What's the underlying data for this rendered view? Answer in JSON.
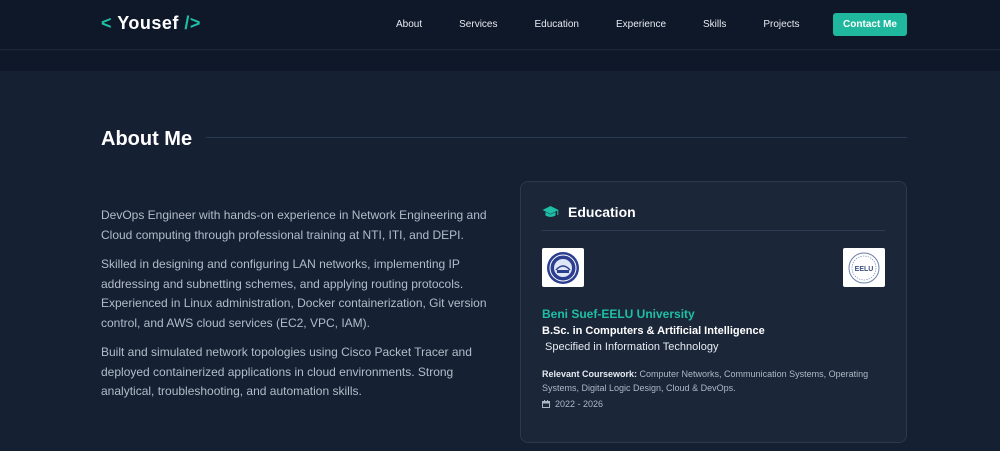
{
  "nav": {
    "logo_open": "<",
    "logo_name": "Yousef",
    "logo_close": "/>",
    "links": [
      "About",
      "Services",
      "Education",
      "Experience",
      "Skills",
      "Projects"
    ],
    "contact_label": "Contact Me"
  },
  "about": {
    "title": "About Me",
    "paragraphs": [
      "DevOps Engineer with hands-on experience in Network Engineering and Cloud computing through professional training at NTI, ITI, and DEPI.",
      "Skilled in designing and configuring LAN networks, implementing IP addressing and subnetting schemes, and applying routing protocols. Experienced in Linux administration, Docker containerization, Git version control, and AWS cloud services (EC2, VPC, IAM).",
      "Built and simulated network topologies using Cisco Packet Tracer and deployed containerized applications in cloud environments. Strong analytical, troubleshooting, and automation skills."
    ]
  },
  "education": {
    "title": "Education",
    "university": "Beni Suef-EELU University",
    "degree": "B.Sc. in Computers & Artificial Intelligence",
    "specialization": "Specified in Information Technology",
    "coursework_label": "Relevant Coursework:",
    "coursework": " Computer Networks, Communication Systems, Operating Systems, Digital Logic Design, Cloud & DevOps.",
    "dates": "2022 - 2026",
    "right_logo_text": "EELU"
  },
  "colors": {
    "accent": "#1fbfa6",
    "background": "#152033",
    "card": "#1b2638"
  }
}
